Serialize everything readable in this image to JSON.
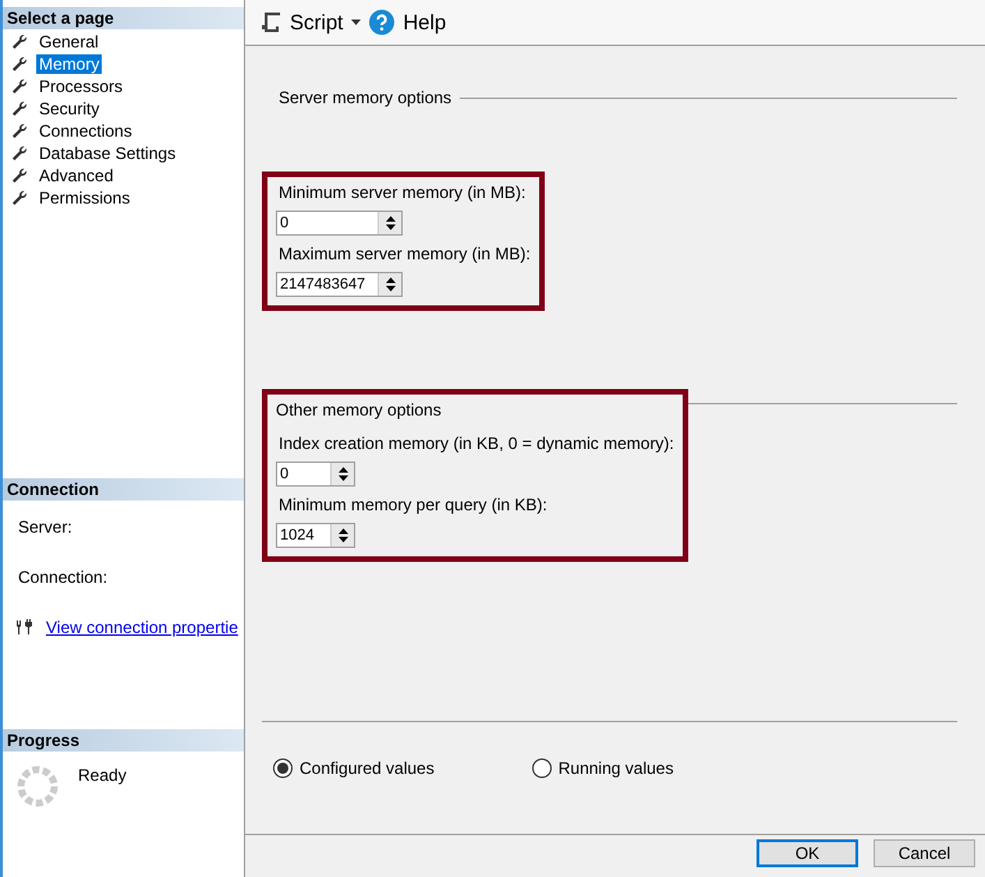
{
  "sidebar": {
    "title": "Select a page",
    "items": [
      {
        "label": "General",
        "selected": false
      },
      {
        "label": "Memory",
        "selected": true
      },
      {
        "label": "Processors",
        "selected": false
      },
      {
        "label": "Security",
        "selected": false
      },
      {
        "label": "Connections",
        "selected": false
      },
      {
        "label": "Database Settings",
        "selected": false
      },
      {
        "label": "Advanced",
        "selected": false
      },
      {
        "label": "Permissions",
        "selected": false
      }
    ]
  },
  "connection": {
    "title": "Connection",
    "labels": [
      "Server:",
      "Connection:"
    ],
    "link": "View connection propertie"
  },
  "progress": {
    "title": "Progress",
    "status": "Ready"
  },
  "toolbar": {
    "script": "Script",
    "help": "Help"
  },
  "groups": [
    {
      "title": "Server memory options",
      "highlighted": true,
      "fields": [
        {
          "label": "Minimum server memory (in MB):",
          "value": "0"
        },
        {
          "label": "Maximum server memory (in MB):",
          "value": "2147483647"
        }
      ]
    },
    {
      "title": "Other memory options",
      "highlighted": true,
      "fields": [
        {
          "label": "Index creation memory (in KB, 0 = dynamic memory):",
          "value": "0"
        },
        {
          "label": "Minimum memory per query (in KB):",
          "value": "1024"
        }
      ]
    }
  ],
  "radios": [
    {
      "label": "Configured values",
      "selected": true
    },
    {
      "label": "Running values",
      "selected": false
    }
  ],
  "buttons": [
    {
      "label": "OK",
      "default": true
    },
    {
      "label": "Cancel",
      "default": false
    }
  ]
}
